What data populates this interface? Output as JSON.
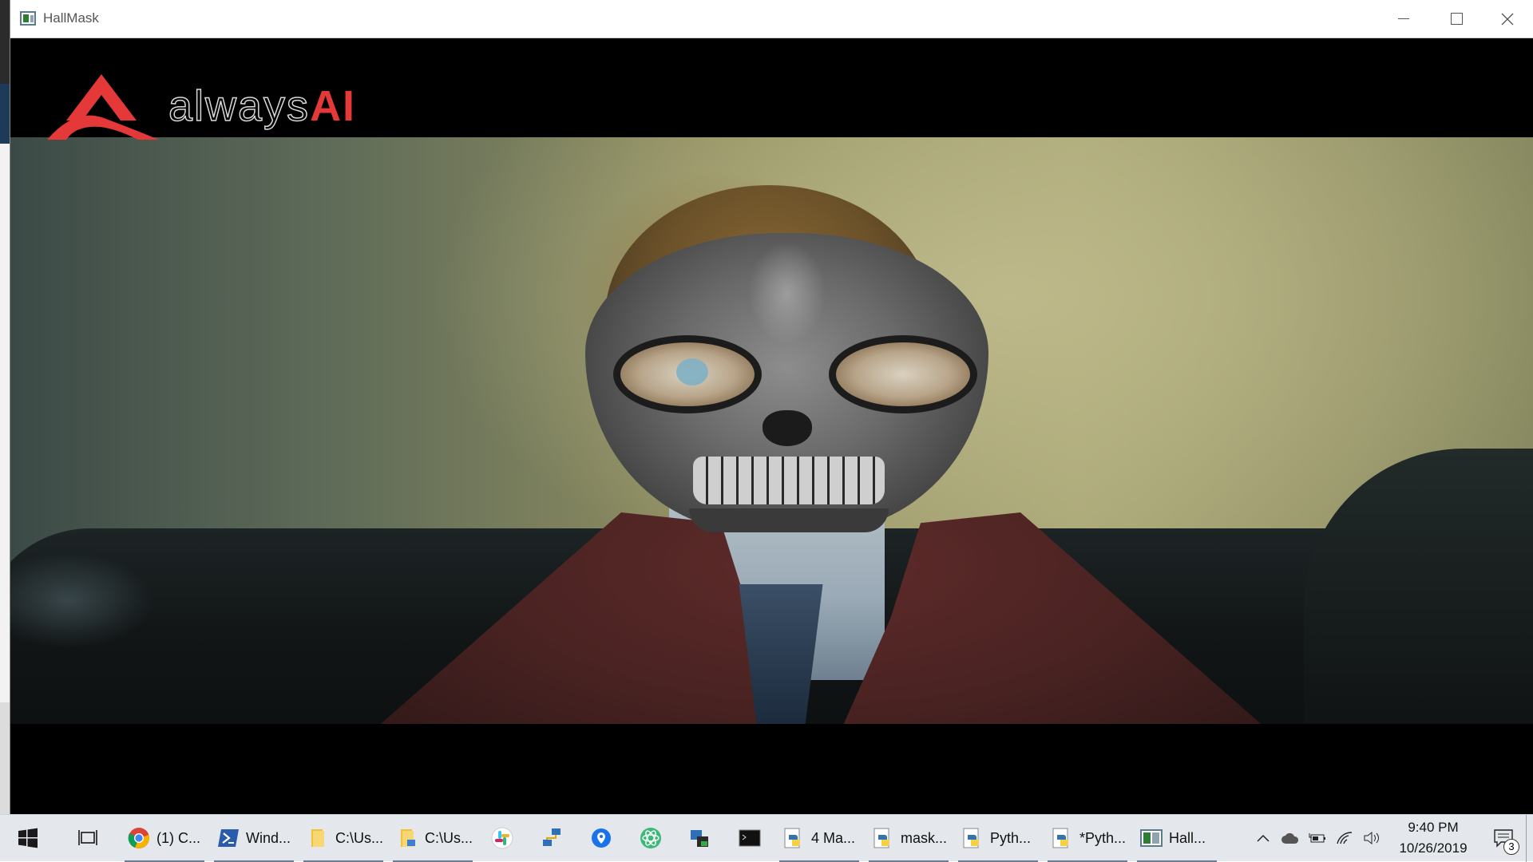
{
  "window": {
    "title": "HallMask"
  },
  "overlay": {
    "logo_word_light": "always",
    "logo_word_accent": "AI",
    "accent_color": "#e53939"
  },
  "taskbar": {
    "start_icon": "windows-icon",
    "task_view_icon": "task-view-icon",
    "apps": [
      {
        "label": "(1) C...",
        "icon": "chrome-icon"
      },
      {
        "label": "Wind...",
        "icon": "powershell-icon"
      },
      {
        "label": "C:\\Us...",
        "icon": "folder-icon"
      },
      {
        "label": "C:\\Us...",
        "icon": "folder-icon"
      },
      {
        "label": "",
        "icon": "slack-icon"
      },
      {
        "label": "",
        "icon": "network-icon"
      },
      {
        "label": "",
        "icon": "maps-pin-icon"
      },
      {
        "label": "",
        "icon": "atom-icon"
      },
      {
        "label": "",
        "icon": "vpn-lock-icon"
      },
      {
        "label": "",
        "icon": "terminal-icon"
      },
      {
        "label": "4 Ma...",
        "icon": "python-icon"
      },
      {
        "label": "mask...",
        "icon": "python-icon"
      },
      {
        "label": "Pyth...",
        "icon": "python-icon"
      },
      {
        "label": "*Pyth...",
        "icon": "python-icon"
      },
      {
        "label": "Hall...",
        "icon": "hallmask-app-icon"
      }
    ],
    "tray": {
      "time": "9:40 PM",
      "date": "10/26/2019",
      "notification_count": "3"
    }
  }
}
